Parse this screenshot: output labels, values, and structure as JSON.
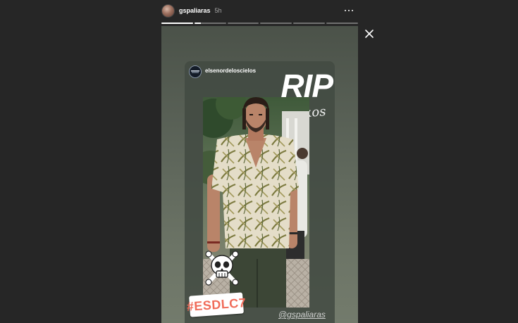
{
  "header": {
    "username": "gspaliaras",
    "timestamp": "5h",
    "more_icon": "more-horizontal-icon",
    "close_icon": "close-icon"
  },
  "progress": {
    "segments": 6,
    "active_index": 1,
    "active_fraction": 0.2
  },
  "story": {
    "original_username": "elsenordeloscielos",
    "overlay_title": "RIP",
    "overlay_name": "Nikos",
    "sticker_icon": "skull-crossbones-sticker",
    "hashtag": "#ESDLC7",
    "mention": "@gspaliaras"
  },
  "colors": {
    "background": "#262626",
    "hashtag_color": "#f06c5a",
    "story_tint": "#5c6459"
  }
}
